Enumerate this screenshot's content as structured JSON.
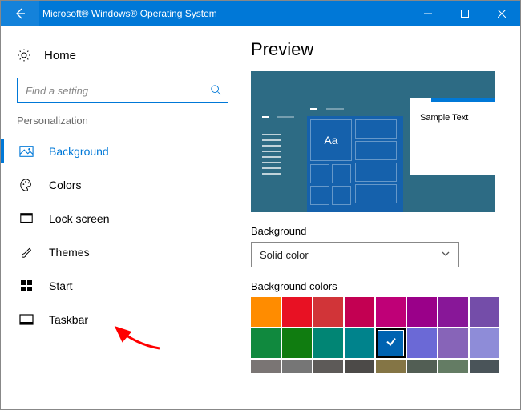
{
  "window": {
    "title": "Microsoft® Windows® Operating System"
  },
  "sidebar": {
    "home": "Home",
    "search_placeholder": "Find a setting",
    "section": "Personalization",
    "items": [
      {
        "label": "Background"
      },
      {
        "label": "Colors"
      },
      {
        "label": "Lock screen"
      },
      {
        "label": "Themes"
      },
      {
        "label": "Start"
      },
      {
        "label": "Taskbar"
      }
    ]
  },
  "main": {
    "heading": "Preview",
    "sample_text": "Sample Text",
    "preview_tile_text": "Aa",
    "bg_label": "Background",
    "bg_value": "Solid color",
    "colors_label": "Background colors",
    "swatches": [
      [
        "#ff8c00",
        "#e81123",
        "#d13438",
        "#c30052",
        "#bf0077",
        "#9a0089",
        "#881798",
        "#744da9"
      ],
      [
        "#10893e",
        "#107c10",
        "#018574",
        "#00838c",
        "#0063b1",
        "#6b69d6",
        "#8764b8",
        "#8e8cd8"
      ],
      [
        "#7a7574",
        "#767676",
        "#5d5a58",
        "#4c4a48",
        "#847545",
        "#525e54",
        "#647c64",
        "#4a5459"
      ]
    ],
    "selected_swatch": [
      1,
      4
    ]
  }
}
